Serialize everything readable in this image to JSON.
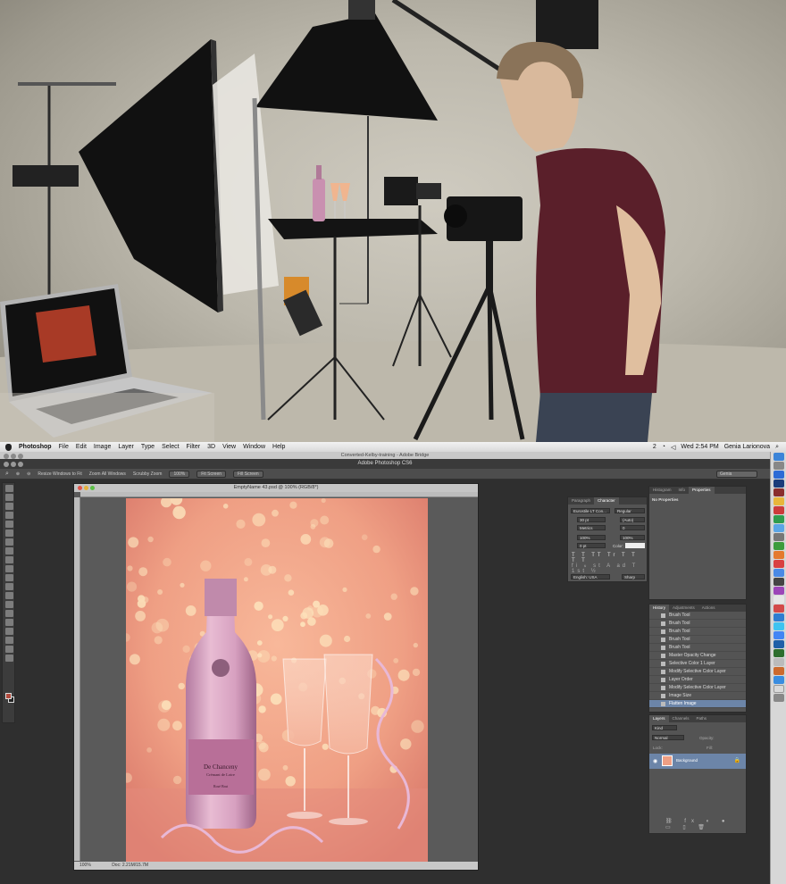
{
  "menubar": {
    "app_name": "Photoshop",
    "items": [
      "File",
      "Edit",
      "Image",
      "Layer",
      "Type",
      "Select",
      "Filter",
      "3D",
      "View",
      "Window",
      "Help"
    ],
    "status_num": "2",
    "clock": "Wed 2:54 PM",
    "user": "Genia Larionova"
  },
  "bridge_title": "Converted-Kelby-training - Adobe Bridge",
  "ps_title": "Adobe Photoshop CS6",
  "options_bar": {
    "resize_windows": "Resize Windows to Fit",
    "zoom_all": "Zoom All Windows",
    "scrubby_zoom": "Scrubby Zoom",
    "btn_100": "100%",
    "btn_fit": "Fit Screen",
    "btn_fill": "Fill Screen",
    "workspace": "Genia"
  },
  "document": {
    "title": "EmptyName 43.psd @ 100% (RGB/8*)",
    "zoom": "100%",
    "doc_size": "Doc: 2.21M/15.7M"
  },
  "character_panel": {
    "tabs": [
      "Paragraph",
      "Character"
    ],
    "font_family": "Eurostile LT Con...",
    "font_style": "Regular",
    "size": "30 pt",
    "leading": "(Auto)",
    "kerning": "Metrics",
    "tracking": "0",
    "vscale": "100%",
    "hscale": "100%",
    "baseline": "0 pt",
    "color_label": "Color:",
    "language": "English: USA",
    "aa": "Sharp"
  },
  "properties_panel": {
    "tabs": [
      "Histogram",
      "Info",
      "Properties"
    ],
    "empty_text": "No Properties"
  },
  "history_panel": {
    "tabs": [
      "History",
      "Adjustments",
      "Actions"
    ],
    "items": [
      "Brush Tool",
      "Brush Tool",
      "Brush Tool",
      "Brush Tool",
      "Brush Tool",
      "Master Opacity Change",
      "Selective Color 1 Layer",
      "Modify Selective Color Layer",
      "Layer Order",
      "Modify Selective Color Layer",
      "Image Size",
      "Flatten Image"
    ]
  },
  "layers_panel": {
    "tabs": [
      "Layers",
      "Channels",
      "Paths"
    ],
    "kind": "Kind",
    "blend": "Normal",
    "opacity_label": "Opacity:",
    "lock_label": "Lock:",
    "fill_label": "Fill:",
    "layer_name": "Background"
  },
  "product": {
    "brand": "De Chanceny",
    "sub": "Crémant de Loire",
    "variety": "Rosé Brut"
  },
  "colors": {
    "accent_selected": "#6c85a8",
    "canvas_bg": "#f3a489",
    "bottle": "#d9a7c0",
    "shirt": "#5a1f2a"
  }
}
